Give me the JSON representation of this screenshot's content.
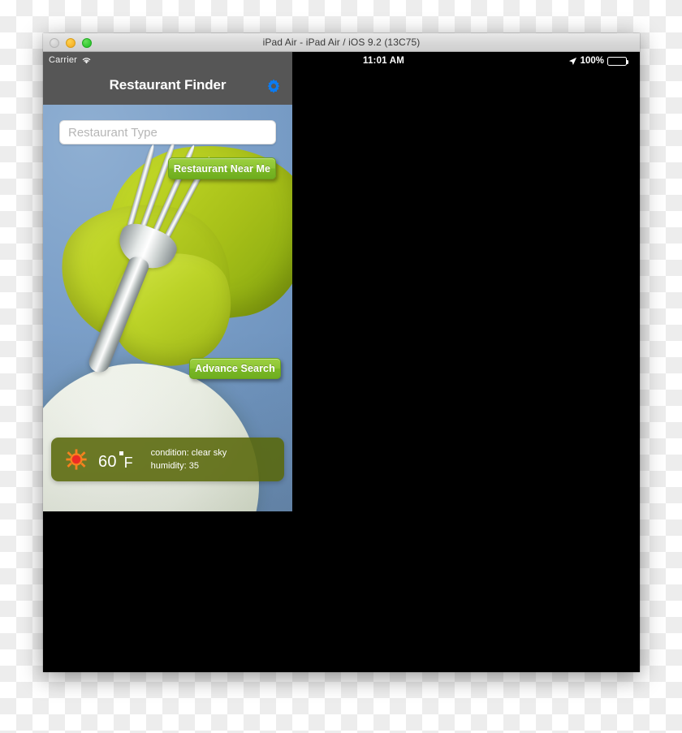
{
  "window": {
    "title": "iPad Air - iPad Air / iOS 9.2 (13C75)",
    "traffic_lights": {
      "close_label": "Close",
      "minimize_label": "Minimize",
      "maximize_label": "Zoom"
    }
  },
  "status_bar": {
    "carrier": "Carrier",
    "wifi_icon": "wifi-icon",
    "time": "11:01 AM",
    "location_icon": "location-arrow-icon",
    "battery_percent": "100%",
    "battery_icon": "battery-full-icon"
  },
  "nav_bar": {
    "title": "Restaurant Finder",
    "settings_icon": "gear-icon"
  },
  "app": {
    "search": {
      "placeholder": "Restaurant Type",
      "value": ""
    },
    "buttons": {
      "near_me": "Restaurant Near Me",
      "advance_search": "Advance Search"
    },
    "weather": {
      "icon": "sun-icon",
      "temperature": "60",
      "degree_symbol": "▪",
      "unit": "F",
      "condition_line": "condition: clear sky",
      "humidity_line": "humidity: 35"
    }
  },
  "colors": {
    "nav_bar": "#565656",
    "status_bar_left": "#565656",
    "status_bar_right": "#000000",
    "accent_blue": "#0a84ff",
    "button_green_top": "#9ccf3f",
    "button_green_bottom": "#6fae1f",
    "weather_bar": "#59680a",
    "sky_blue": "#7b9fc8",
    "napkin_green": "#bad122",
    "sun_orange": "#f58220",
    "sun_center_red": "#ee2b24"
  }
}
